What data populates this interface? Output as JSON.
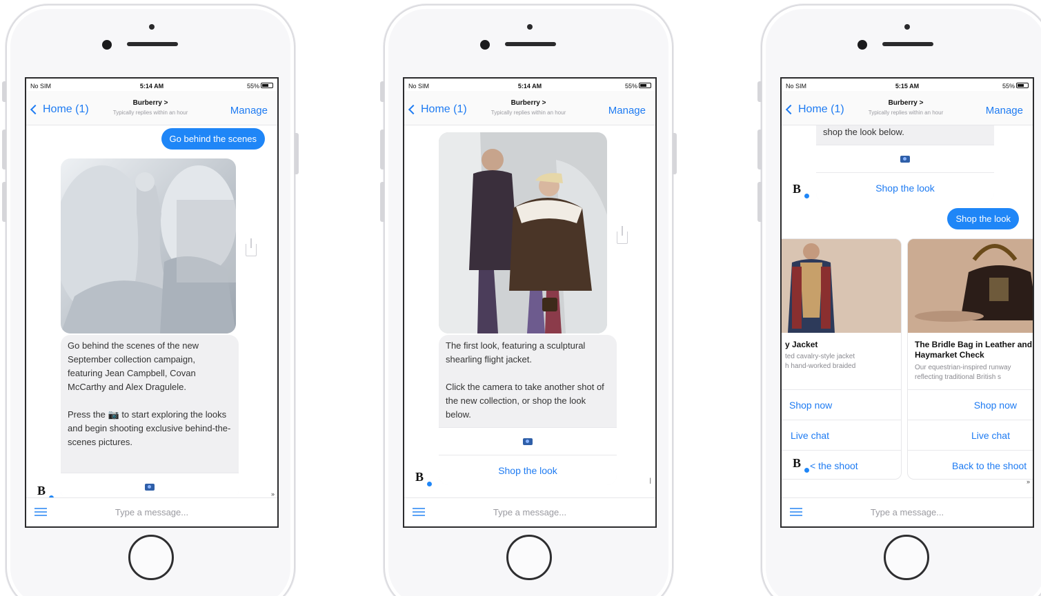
{
  "status_bar": [
    {
      "carrier": "No SIM",
      "time": "5:14 AM",
      "battery": "55%"
    },
    {
      "carrier": "No SIM",
      "time": "5:14 AM",
      "battery": "55%"
    },
    {
      "carrier": "No SIM",
      "time": "5:15 AM",
      "battery": "55%"
    }
  ],
  "nav": {
    "back_label": "Home (1)",
    "title": "Burberry >",
    "subtitle": "Typically replies within an hour",
    "manage_label": "Manage"
  },
  "composer": {
    "placeholder": "Type a message..."
  },
  "brand": {
    "avatar_letter": "B",
    "accent": "#1f86f7"
  },
  "screen1": {
    "user_message": "Go behind the scenes",
    "card_text": "Go behind the scenes of the new September collection campaign, featuring Jean Campbell, Covan McCarthy and Alex Dragulele.\n\nPress the 📷 to start exploring the looks and begin shooting exclusive behind-the-scenes pictures."
  },
  "screen2": {
    "card_text": "The first look, featuring a sculptural shearling flight jacket.\n\nClick the camera to take another shot of the new collection, or shop the look below.",
    "shop_label": "Shop the look"
  },
  "screen3": {
    "prev_card_tail": "shop the look below.",
    "prev_shop_label": "Shop the look",
    "user_message": "Shop the look",
    "products": [
      {
        "title": "y Jacket",
        "desc": "ted cavalry-style jacket\nh hand-worked braided",
        "buttons": [
          "Shop now",
          "Live chat",
          "< the shoot"
        ]
      },
      {
        "title": "The Bridle Bag in Leather and\nHaymarket Check",
        "desc": "Our equestrian-inspired runway\nreflecting traditional British s",
        "buttons": [
          "Shop now",
          "Live chat",
          "Back to the shoot"
        ]
      }
    ]
  },
  "icons": {
    "back": "chevron-left-icon",
    "menu": "hamburger-menu-icon",
    "camera": "camera-icon",
    "share": "share-icon"
  }
}
